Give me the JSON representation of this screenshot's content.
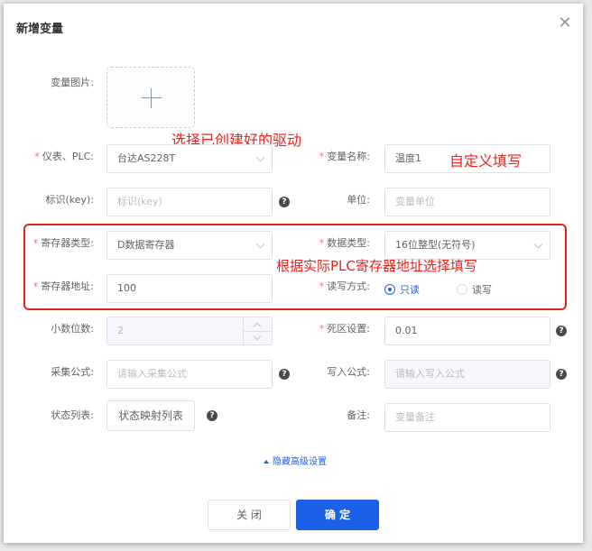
{
  "dialog": {
    "title": "新增变量",
    "close_icon": "close-icon"
  },
  "form": {
    "image_label": "变量图片:",
    "device": {
      "label": "仪表、PLC:",
      "value": "台达AS228T"
    },
    "var_name": {
      "label": "变量名称:",
      "value": "温度1"
    },
    "identifier": {
      "label": "标识(key):",
      "placeholder": "标识(key)"
    },
    "unit": {
      "label": "单位:",
      "placeholder": "变量单位"
    },
    "register_type": {
      "label": "寄存器类型:",
      "value": "D数据寄存器"
    },
    "data_type": {
      "label": "数据类型:",
      "value": "16位整型(无符号)"
    },
    "register_address": {
      "label": "寄存器地址:",
      "value": "100"
    },
    "rw_mode": {
      "label": "读写方式:",
      "options": [
        "只读",
        "读写"
      ],
      "selected": "只读"
    },
    "decimals": {
      "label": "小数位数:",
      "value": "2"
    },
    "dead_zone": {
      "label": "死区设置:",
      "value": "0.01"
    },
    "collect_formula": {
      "label": "采集公式:",
      "placeholder": "请输入采集公式"
    },
    "write_formula": {
      "label": "写入公式:",
      "placeholder": "请输入写入公式"
    },
    "status_list": {
      "label": "状态列表:",
      "button": "状态映射列表"
    },
    "remark": {
      "label": "备注:",
      "placeholder": "变量备注"
    },
    "required_mark": "*",
    "help_mark": "?"
  },
  "advanced_toggle": "隐藏高级设置",
  "footer": {
    "close": "关 闭",
    "confirm": "确 定"
  },
  "annotations": {
    "select_driver": "选择已创建好的驱动",
    "custom_fill": "自定义填写",
    "register_fill": "根据实际PLC寄存器地址选择填写"
  },
  "colors": {
    "accent": "#1d60e8",
    "annotation": "#e8221f",
    "required": "#f56c6c"
  }
}
